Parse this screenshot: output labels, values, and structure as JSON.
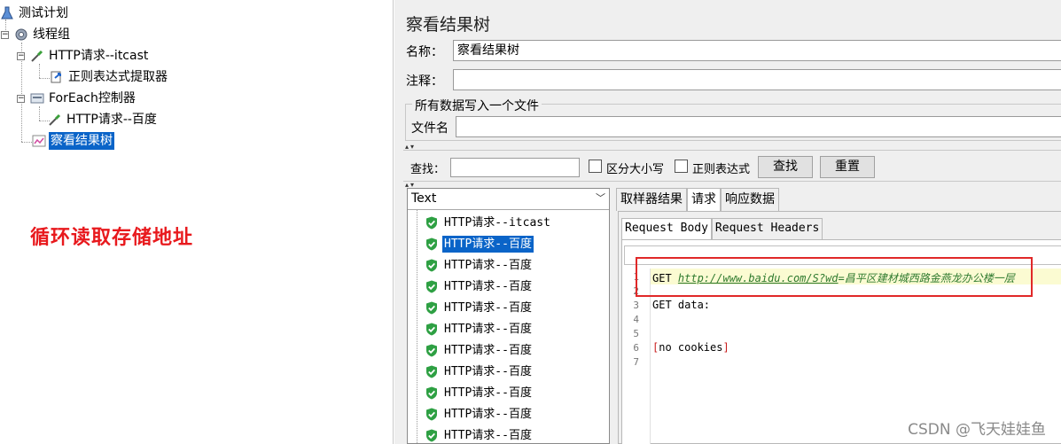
{
  "tree": {
    "root": "测试计划",
    "thread_group": "线程组",
    "http_itcast": "HTTP请求--itcast",
    "regex_extractor": "正则表达式提取器",
    "foreach": "ForEach控制器",
    "http_baidu": "HTTP请求--百度",
    "result_tree": "察看结果树"
  },
  "annotation": "循环读取存储地址",
  "panel": {
    "title": "察看结果树",
    "name_label": "名称：",
    "name_value": "察看结果树",
    "comment_label": "注释：",
    "comment_value": "",
    "group_title": "所有数据写入一个文件",
    "filename_label": "文件名",
    "filename_value": ""
  },
  "search": {
    "label": "查找：",
    "value": "",
    "case_label": "区分大小写",
    "regex_label": "正则表达式",
    "find_button": "查找",
    "reset_button": "重置"
  },
  "results": {
    "header": "Text",
    "items": [
      {
        "label": "HTTP请求--itcast",
        "selected": false
      },
      {
        "label": "HTTP请求--百度",
        "selected": true
      },
      {
        "label": "HTTP请求--百度",
        "selected": false
      },
      {
        "label": "HTTP请求--百度",
        "selected": false
      },
      {
        "label": "HTTP请求--百度",
        "selected": false
      },
      {
        "label": "HTTP请求--百度",
        "selected": false
      },
      {
        "label": "HTTP请求--百度",
        "selected": false
      },
      {
        "label": "HTTP请求--百度",
        "selected": false
      },
      {
        "label": "HTTP请求--百度",
        "selected": false
      },
      {
        "label": "HTTP请求--百度",
        "selected": false
      },
      {
        "label": "HTTP请求--百度",
        "selected": false
      }
    ]
  },
  "tabs": {
    "sampler_result": "取样器结果",
    "request": "请求",
    "response_data": "响应数据"
  },
  "subtabs": {
    "request_body": "Request Body",
    "request_headers": "Request Headers"
  },
  "code": {
    "line_numbers": [
      "1",
      "2",
      "3",
      "4",
      "5",
      "6",
      "7"
    ],
    "line1_method": "GET ",
    "line1_url": "http://www.baidu.com/S?wd",
    "line1_query": "=昌平区建材城西路金燕龙办公楼一层",
    "line3": "GET data:",
    "line6": "[no cookies]"
  },
  "watermark": "CSDN @飞天娃娃鱼",
  "colors": {
    "selection": "#0a64c8",
    "annotation_red": "#e8191d",
    "url_green": "#2e7a2e",
    "success_shield": "#2ea043"
  }
}
